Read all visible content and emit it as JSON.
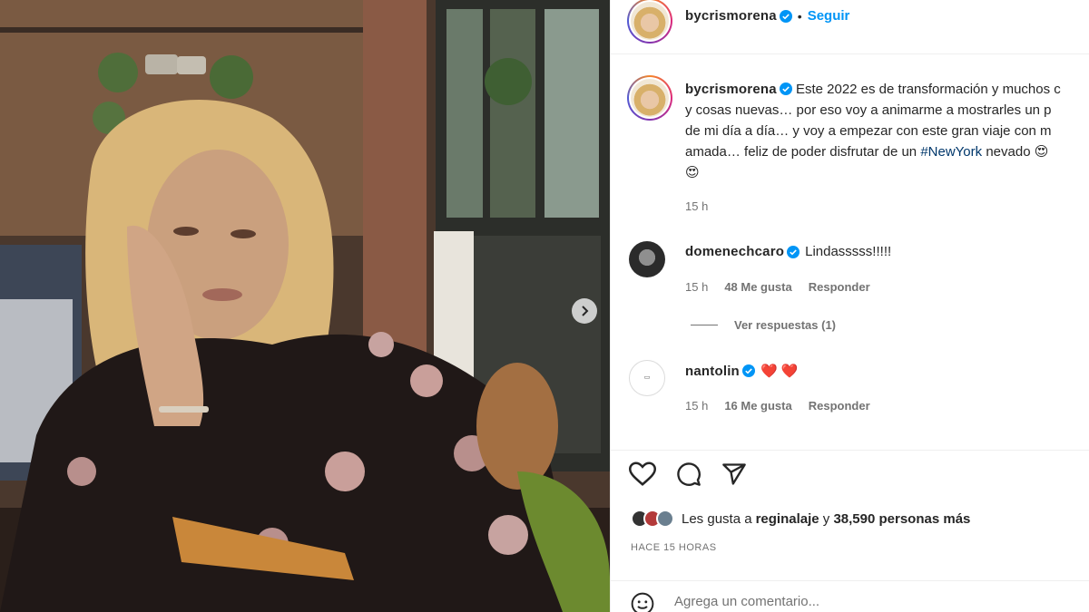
{
  "post": {
    "author": "bycrismorena",
    "follow_label": "Seguir",
    "separator": "•",
    "caption_user": "bycrismorena",
    "caption_lines": [
      "Este 2022 es de transformación y muchos c",
      "y cosas nuevas… por eso voy a animarme a mostrarles un p",
      "de mi día a día… y voy a empezar con este gran viaje con m",
      "amada… feliz de poder disfrutar de un "
    ],
    "hashtag": "#NewYork",
    "caption_tail": " nevado 😍",
    "caption_last_line": "😍",
    "caption_time": "15 h"
  },
  "comments": [
    {
      "user": "domenechcaro",
      "text": "Lindasssss!!!!!",
      "time": "15 h",
      "likes": "48 Me gusta",
      "reply": "Responder",
      "view_replies": "Ver respuestas (1)"
    },
    {
      "user": "nantolin",
      "text": "❤️ ❤️",
      "time": "15 h",
      "likes": "16 Me gusta",
      "reply": "Responder"
    }
  ],
  "likes_summary": {
    "prefix": "Les gusta a ",
    "user": "reginalaje",
    "middle": " y ",
    "count": "38,590 personas más"
  },
  "date_label": "HACE 15 HORAS",
  "add_comment_placeholder": "Agrega un comentario...",
  "colors": {
    "link_blue": "#0095f6",
    "hashtag": "#00376b",
    "muted": "#737373",
    "heart_red": "#ed2a45"
  },
  "icons": [
    "heart-icon",
    "comment-icon",
    "share-icon",
    "emoji-icon",
    "verified-icon",
    "chevron-right-icon"
  ]
}
